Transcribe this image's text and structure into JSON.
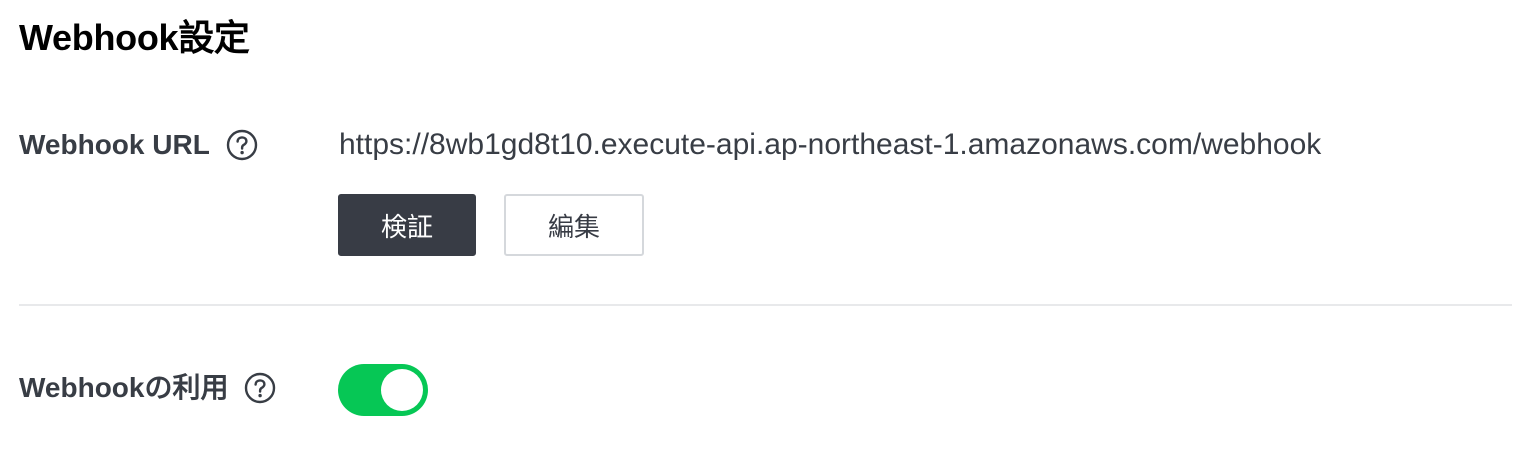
{
  "page": {
    "title": "Webhook設定"
  },
  "webhook_url": {
    "label": "Webhook URL",
    "value": "https://8wb1gd8t10.execute-api.ap-northeast-1.amazonaws.com/webhook",
    "verify_button_label": "検証",
    "edit_button_label": "編集"
  },
  "webhook_use": {
    "label": "Webhookの利用",
    "enabled": true
  },
  "colors": {
    "toggle_on": "#06c755",
    "primary_button": "#383c45",
    "text": "#383d45"
  },
  "icons": {
    "help": "question-circle-icon"
  }
}
